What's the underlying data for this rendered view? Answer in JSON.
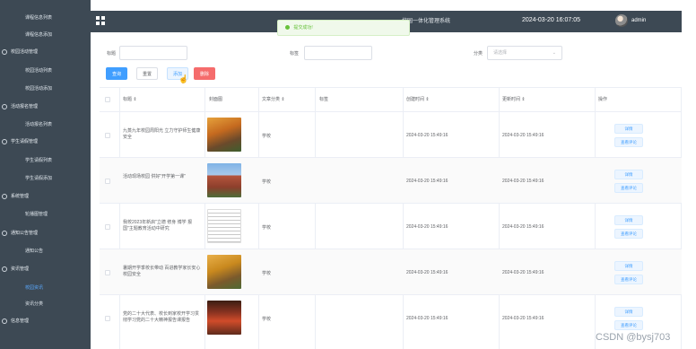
{
  "sidebar": {
    "items": [
      {
        "label": "课程信息列表",
        "kind": "sub"
      },
      {
        "label": "课程信息添加",
        "kind": "sub"
      },
      {
        "label": "校园活动管理",
        "kind": "grp"
      },
      {
        "label": "校园活动列表",
        "kind": "sub"
      },
      {
        "label": "校园活动添加",
        "kind": "sub"
      },
      {
        "label": "活动报名管理",
        "kind": "grp"
      },
      {
        "label": "活动报名列表",
        "kind": "sub"
      },
      {
        "label": "学生请假管理",
        "kind": "grp"
      },
      {
        "label": "学生请假列表",
        "kind": "sub"
      },
      {
        "label": "学生请假添加",
        "kind": "sub"
      },
      {
        "label": "系统管理",
        "kind": "grp"
      },
      {
        "label": "轮播图管理",
        "kind": "sub"
      },
      {
        "label": "通知公告管理",
        "kind": "grp"
      },
      {
        "label": "通知公告",
        "kind": "sub"
      },
      {
        "label": "资讯管理",
        "kind": "grp"
      },
      {
        "label": "校园资讯",
        "kind": "sub",
        "active": true
      },
      {
        "label": "资讯分类",
        "kind": "sub"
      },
      {
        "label": "信息管理",
        "kind": "grp"
      }
    ]
  },
  "topbar": {
    "title": "校园一体化管理系统",
    "time": "2024-03-20 16:07:05",
    "user": "admin"
  },
  "toast": {
    "message": "提交成功!"
  },
  "filters": {
    "label1": "标题",
    "label2": "标签",
    "label3": "分类",
    "select_placeholder": "请选择"
  },
  "toolbar": {
    "query": "查询",
    "reset": "重置",
    "add": "添加",
    "delete": "删除"
  },
  "table": {
    "headers": [
      "标题 ⇕",
      "封面图",
      "文章分类 ⇕",
      "标签",
      "创建时间 ⇕",
      "更新时间 ⇕",
      "操作"
    ],
    "rows": [
      {
        "title": "九蒸九年校园周阳光 立力守护师生健康安全",
        "category": "学校",
        "created": "2024-03-20 15:49:16",
        "updated": "2024-03-20 15:49:16",
        "thumb": "t1"
      },
      {
        "title": "活动现场校园 供好\"开学第一课\"",
        "category": "学校",
        "created": "2024-03-20 15:49:16",
        "updated": "2024-03-20 15:49:16",
        "thumb": "t2"
      },
      {
        "title": "我校2023年新启\"立德 修身 博学 报国\"主题教育活动中研究",
        "category": "学校",
        "created": "2024-03-20 15:49:16",
        "updated": "2024-03-20 15:49:16",
        "thumb": "t3"
      },
      {
        "title": "暑期开学季校长带动 百进教学家长安心校园安全",
        "category": "学校",
        "created": "2024-03-20 15:49:16",
        "updated": "2024-03-20 15:49:16",
        "thumb": "t4"
      },
      {
        "title": "党的二十大代表、校长到家校开学习贯彻学习党的二十大精神报告课报告",
        "category": "学校",
        "created": "2024-03-20 15:49:16",
        "updated": "2024-03-20 15:49:16",
        "thumb": "t5"
      }
    ],
    "action_detail": "详情",
    "action_review": "查看评论"
  },
  "watermark": "CSDN @bysj703"
}
